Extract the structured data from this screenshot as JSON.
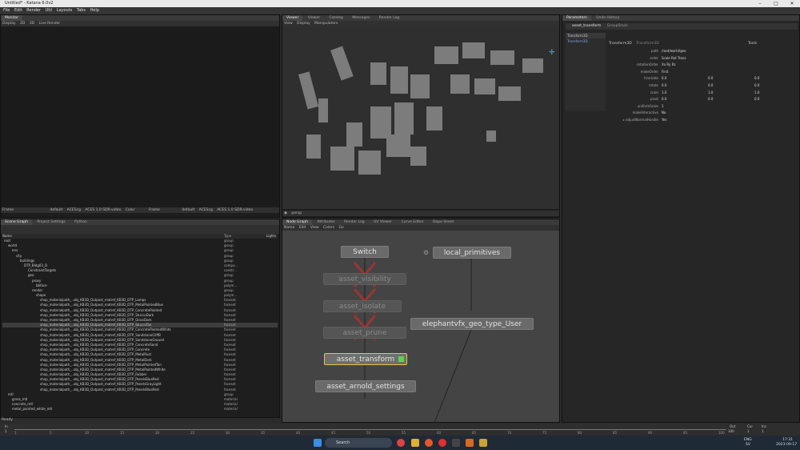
{
  "app": {
    "title": "Untitled* - Katana 6.0v2",
    "status": "Ready"
  },
  "menu": [
    "File",
    "Edit",
    "Render",
    "Util",
    "Layouts",
    "Tabs",
    "Help"
  ],
  "monitor": {
    "tab": "Monitor",
    "toolbar": [
      "Display",
      "2D",
      "3D",
      "Live Render"
    ],
    "footer_left": [
      "Frame",
      "default",
      "ACEScg",
      "ACES 1.0 SDR-video",
      "Color"
    ],
    "footer_right": [
      "Frame",
      "default",
      "ACEScg",
      "ACES 1.0 SDR-video",
      "Color"
    ]
  },
  "viewer": {
    "tabs": [
      "Viewer",
      "Viewer",
      "Catalog",
      "Messages",
      "Render Log"
    ],
    "toolbar": [
      "View",
      "Display",
      "Manipulators"
    ],
    "footer_camera": "persp"
  },
  "parameters": {
    "tabs": [
      "Parameters",
      "Undo History"
    ],
    "node_name": "asset_transform",
    "node_type": "GroupStack",
    "child_list_header": "Transform3D",
    "child_list_item": "Transform3D",
    "section": "Transform3D",
    "section_sub": "Transform3D",
    "tools": "Tools",
    "rows": [
      {
        "label": "path",
        "value": "/root/world/geo"
      },
      {
        "label": "order",
        "value": "Scale Rot Trans"
      },
      {
        "label": "rotationOrder",
        "value": "Xx Ry Rz"
      },
      {
        "label": "makeOrder",
        "value": "First"
      },
      {
        "label": "translate",
        "v1": "0.0",
        "v2": "0.0",
        "v3": "0.0"
      },
      {
        "label": "rotate",
        "v1": "0.0",
        "v2": "0.0",
        "v3": "0.0"
      },
      {
        "label": "scale",
        "v1": "1.0",
        "v2": "1.0",
        "v3": "1.0"
      },
      {
        "label": "pivot",
        "v1": "0.0",
        "v2": "0.0",
        "v3": "0.0"
      },
      {
        "label": "uniformScale",
        "value": "1"
      },
      {
        "label": "makeInteractive",
        "value": "No"
      },
      {
        "label": "▸ adjustNormalHandle",
        "value": "Yes"
      }
    ]
  },
  "scenegraph": {
    "tabs": [
      "Scene Graph",
      "Project Settings",
      "Python"
    ],
    "header": {
      "name": "Name",
      "type": "Type",
      "lights": "Lights"
    },
    "rows": [
      {
        "indent": 0,
        "name": "root",
        "type": "group"
      },
      {
        "indent": 1,
        "name": "world",
        "type": "group"
      },
      {
        "indent": 2,
        "name": "env",
        "type": "group"
      },
      {
        "indent": 3,
        "name": "city",
        "type": "group"
      },
      {
        "indent": 4,
        "name": "buildings",
        "type": "group"
      },
      {
        "indent": 5,
        "name": "DTP_Bldg03_D",
        "type": "compo..."
      },
      {
        "indent": 6,
        "name": "ConstraintTargets",
        "type": "constr..."
      },
      {
        "indent": 6,
        "name": "geo",
        "type": "group"
      },
      {
        "indent": 7,
        "name": "proxy",
        "type": "group"
      },
      {
        "indent": 8,
        "name": "bbface",
        "type": "polym..."
      },
      {
        "indent": 7,
        "name": "render",
        "type": "group"
      },
      {
        "indent": 8,
        "name": "shape",
        "type": "polym..."
      },
      {
        "indent": 9,
        "name": "shop_materialpath_..obj_KB3D_Outpost_matref_KB3D_DTP_Lamps",
        "type": "faceset"
      },
      {
        "indent": 9,
        "name": "shop_materialpath_..obj_KB3D_Outpost_matref_KB3D_DTP_MetalPaintedBlue",
        "type": "faceset"
      },
      {
        "indent": 9,
        "name": "shop_materialpath_..obj_KB3D_Outpost_matref_KB3D_DTP_ConcretePainted",
        "type": "faceset"
      },
      {
        "indent": 9,
        "name": "shop_materialpath_..obj_KB3D_Outpost_matref_KB3D_DTP_StuccoDark",
        "type": "faceset"
      },
      {
        "indent": 9,
        "name": "shop_materialpath_..obj_KB3D_Outpost_matref_KB3D_DTP_GlassDark",
        "type": "faceset"
      },
      {
        "indent": 9,
        "name": "shop_materialpath_..obj_KB3D_Outpost_matref_KB3D_DTP_StuccoTan",
        "type": "faceset",
        "selected": true
      },
      {
        "indent": 9,
        "name": "shop_materialpath_..obj_KB3D_Outpost_matref_KB3D_DTP_ConcretePaintedWhite",
        "type": "faceset"
      },
      {
        "indent": 9,
        "name": "shop_materialpath_..obj_KB3D_Outpost_matref_KB3D_DTP_SandstoneCliffB",
        "type": "faceset"
      },
      {
        "indent": 9,
        "name": "shop_materialpath_..obj_KB3D_Outpost_matref_KB3D_DTP_SandstoneGround",
        "type": "faceset"
      },
      {
        "indent": 9,
        "name": "shop_materialpath_..obj_KB3D_Outpost_matref_KB3D_DTP_ConcreteSand",
        "type": "faceset"
      },
      {
        "indent": 9,
        "name": "shop_materialpath_..obj_KB3D_Outpost_matref_KB3D_DTP_Concrete",
        "type": "faceset"
      },
      {
        "indent": 9,
        "name": "shop_materialpath_..obj_KB3D_Outpost_matref_KB3D_DTP_MetalRust",
        "type": "faceset"
      },
      {
        "indent": 9,
        "name": "shop_materialpath_..obj_KB3D_Outpost_matref_KB3D_DTP_MetalDark",
        "type": "faceset"
      },
      {
        "indent": 9,
        "name": "shop_materialpath_..obj_KB3D_Outpost_matref_KB3D_DTP_MetalPaintedTan",
        "type": "faceset"
      },
      {
        "indent": 9,
        "name": "shop_materialpath_..obj_KB3D_Outpost_matref_KB3D_DTP_MetalPaintedWhite",
        "type": "faceset"
      },
      {
        "indent": 9,
        "name": "shop_materialpath_..obj_KB3D_Outpost_matref_KB3D_DTP_Rubber",
        "type": "faceset"
      },
      {
        "indent": 9,
        "name": "shop_materialpath_..obj_KB3D_Outpost_matref_KB3D_DTP_PanelsBlueRed",
        "type": "faceset"
      },
      {
        "indent": 9,
        "name": "shop_materialpath_..obj_KB3D_Outpost_matref_KB3D_DTP_PanelsGrayLight",
        "type": "faceset"
      },
      {
        "indent": 9,
        "name": "shop_materialpath_..obj_KB3D_Outpost_matref_KB3D_DTP_PanelsBlueRed",
        "type": "faceset"
      },
      {
        "indent": 1,
        "name": "mtl",
        "type": "group"
      },
      {
        "indent": 2,
        "name": "grass_mtl",
        "type": "material"
      },
      {
        "indent": 2,
        "name": "concrete_mtl",
        "type": "material"
      },
      {
        "indent": 2,
        "name": "metal_painted_white_mtl",
        "type": "material"
      }
    ]
  },
  "nodegraph": {
    "tabs": [
      "Node Graph",
      "Attributes",
      "Render Log",
      "UV Viewer",
      "Curve Editor",
      "Dope Sheet"
    ],
    "toolbar": [
      "Name",
      "Edit",
      "View",
      "Colors",
      "Go"
    ],
    "nodes": {
      "switch": "Switch",
      "local_primitives": "local_primitives",
      "asset_visibility": "asset_visibility",
      "asset_isolate": "asset_isolate",
      "asset_prune": "asset_prune",
      "elephant": "elephantvfx_geo_type_User",
      "asset_transform": "asset_transform",
      "asset_arnold_settings": "asset_arnold_settings"
    }
  },
  "timeline": {
    "ticks": [
      "1",
      "5",
      "10",
      "15",
      "20",
      "25",
      "30",
      "35",
      "40",
      "45",
      "50",
      "55",
      "60",
      "65",
      "70",
      "75",
      "80",
      "85",
      "90",
      "95",
      "100"
    ],
    "in_label": "In",
    "out_label": "Out",
    "cur_label": "Cur",
    "inc_label": "Inc",
    "in_val": "1",
    "out_val": "100",
    "cur_val": "1",
    "inc_val": "1"
  },
  "taskbar": {
    "search": "Search",
    "lang": "ENG",
    "region": "SV",
    "time": "17:31",
    "date": "2023-09-17"
  }
}
